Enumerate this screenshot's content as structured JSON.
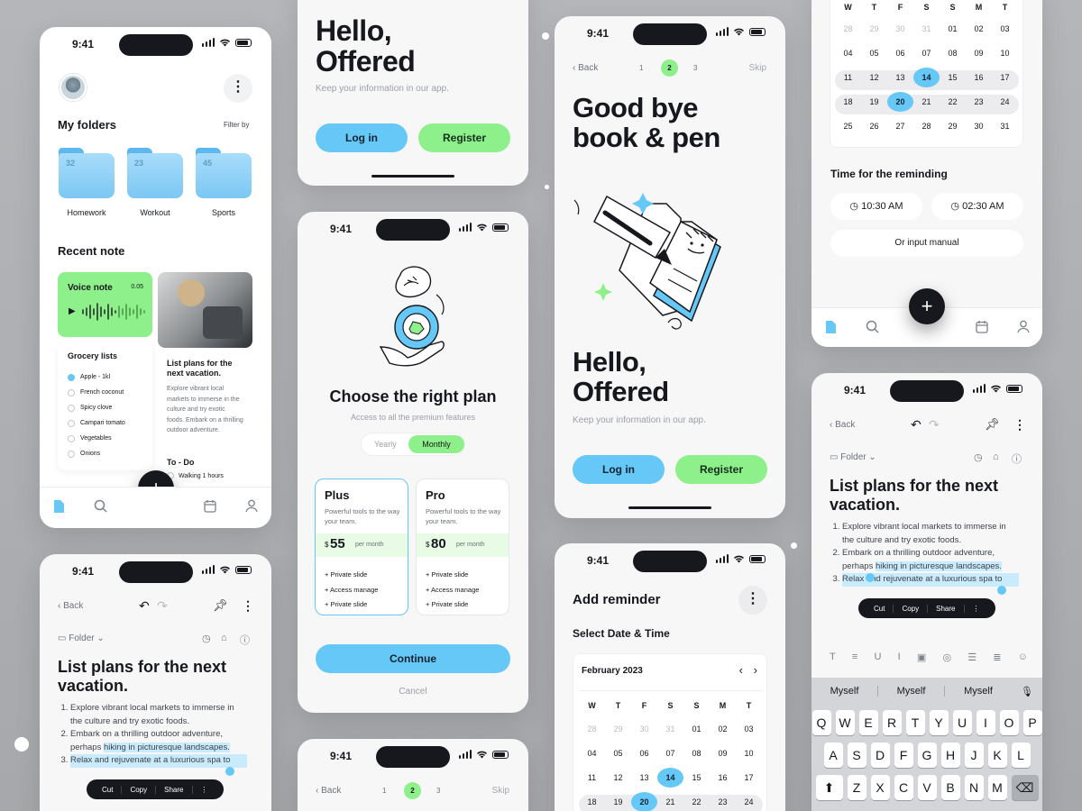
{
  "status": {
    "time": "9:41"
  },
  "folders_screen": {
    "title": "My folders",
    "filter": "Filter by",
    "folders": [
      {
        "name": "Homework",
        "count": "32"
      },
      {
        "name": "Workout",
        "count": "23"
      },
      {
        "name": "Sports",
        "count": "45"
      }
    ],
    "recent": "Recent note",
    "voice": {
      "title": "Voice note",
      "time": "0.05"
    },
    "grocery": {
      "title": "Grocery lists",
      "items": [
        "Apple - 1kl",
        "French coconut",
        "Spicy clove",
        "Campari tomato",
        "Vegetables",
        "Onions"
      ]
    },
    "note": {
      "title": "List plans for the next vacation.",
      "body": "Explore vibrant local markets to immerse in the culture and try exotic foods. Embark on a thrilling outdoor adventure."
    },
    "todo": {
      "title": "To - Do",
      "item": "Walking 1 hours"
    },
    "fab": "+"
  },
  "hello_top": {
    "title_line1": "Hello,",
    "title_line2": "Offered",
    "subtitle": "Keep your information in our app.",
    "login": "Log in",
    "register": "Register"
  },
  "plan_screen": {
    "title": "Choose the right plan",
    "subtitle": "Access to all the premium features",
    "toggle": [
      "Yearly",
      "Monthly"
    ],
    "plans": [
      {
        "name": "Plus",
        "desc": "Powerful tools to the way your team.",
        "price": "55",
        "per": "per month",
        "features": [
          "+ Private slide",
          "+ Access manage",
          "+ Private slide"
        ]
      },
      {
        "name": "Pro",
        "desc": "Powerful tools to the way your team.",
        "price": "80",
        "per": "per month",
        "features": [
          "+ Private slide",
          "+ Access manage",
          "+ Private slide"
        ]
      }
    ],
    "continue": "Continue",
    "cancel": "Cancel",
    "currency": "$"
  },
  "onboarding": {
    "back": "Back",
    "steps": [
      "1",
      "2",
      "3"
    ],
    "skip": "Skip",
    "headline_line1": "Good bye",
    "headline_line2": "book & pen",
    "title_line1": "Hello,",
    "title_line2": "Offered",
    "subtitle": "Keep your information in our app.",
    "login": "Log in",
    "register": "Register"
  },
  "reminder": {
    "title": "Add reminder",
    "section": "Select Date & Time",
    "month": "February 2023",
    "weekdays": [
      "W",
      "T",
      "F",
      "S",
      "S",
      "M",
      "T"
    ],
    "rows": [
      [
        "28",
        "29",
        "30",
        "31",
        "01",
        "02",
        "03"
      ],
      [
        "04",
        "05",
        "06",
        "07",
        "08",
        "09",
        "10"
      ],
      [
        "11",
        "12",
        "13",
        "14",
        "15",
        "16",
        "17"
      ],
      [
        "18",
        "19",
        "20",
        "21",
        "22",
        "23",
        "24"
      ]
    ]
  },
  "calendar_top": {
    "weekdays": [
      "W",
      "T",
      "F",
      "S",
      "S",
      "M",
      "T"
    ],
    "rows": [
      [
        "28",
        "29",
        "30",
        "31",
        "01",
        "02",
        "03"
      ],
      [
        "04",
        "05",
        "06",
        "07",
        "08",
        "09",
        "10"
      ],
      [
        "11",
        "12",
        "13",
        "14",
        "15",
        "16",
        "17"
      ],
      [
        "18",
        "19",
        "20",
        "21",
        "22",
        "23",
        "24"
      ],
      [
        "25",
        "26",
        "27",
        "28",
        "29",
        "30",
        "31"
      ]
    ],
    "time_label": "Time for the reminding",
    "time1": "10:30 AM",
    "time2": "02:30 AM",
    "manual": "Or input manual"
  },
  "note_editor": {
    "back": "Back",
    "folder": "Folder",
    "title": "List plans for the next vacation.",
    "items": [
      "Explore vibrant local markets to immerse in the culture and try exotic foods.",
      "Embark on a thrilling outdoor adventure, perhaps hiking in picturesque landscapes.",
      "Relax and rejuvenate at a luxurious spa to"
    ],
    "highlight": "hiking in picturesque landscapes.",
    "cut": "Cut",
    "copy": "Copy",
    "share": "Share",
    "suggestions": [
      "Myself",
      "Myself",
      "Myself"
    ],
    "keys_row1": [
      "Q",
      "W",
      "E",
      "R",
      "T",
      "Y",
      "U",
      "I",
      "O",
      "P"
    ],
    "keys_row2": [
      "A",
      "S",
      "D",
      "F",
      "G",
      "H",
      "J",
      "K",
      "L"
    ],
    "keys_row3": [
      "Z",
      "X",
      "C",
      "V",
      "B",
      "N",
      "M"
    ]
  }
}
